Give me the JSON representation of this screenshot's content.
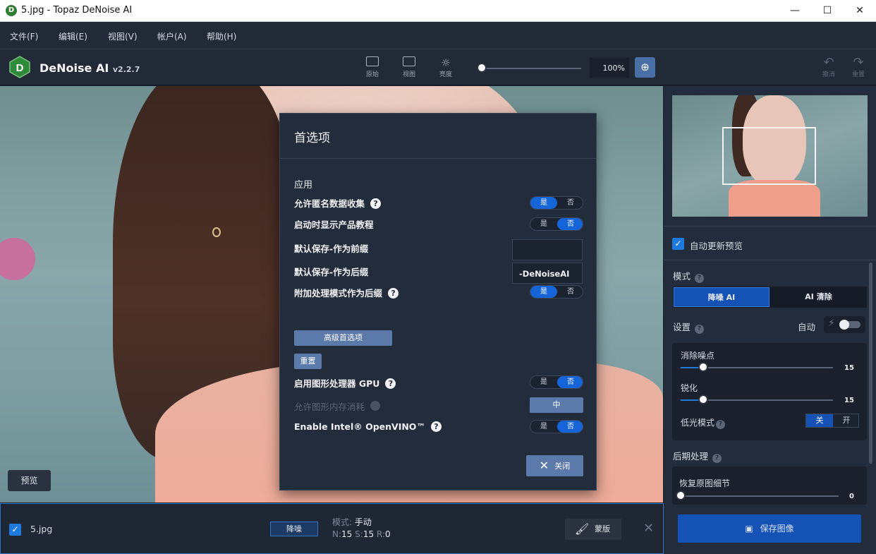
{
  "window": {
    "title": "5.jpg - Topaz DeNoise AI",
    "minimize": "—",
    "maximize": "☐",
    "close": "✕"
  },
  "menu": [
    "文件(F)",
    "编辑(E)",
    "视图(V)",
    "帐户(A)",
    "帮助(H)"
  ],
  "toolbar": {
    "brand": "DeNoise AI",
    "version": "v2.2.7",
    "buttons": [
      "原始",
      "视图",
      "亮度"
    ],
    "zoom": "100%",
    "zoom_fraction": 0.05,
    "undo": "撤消",
    "redo": "重置"
  },
  "preview_button": "预览",
  "dialog": {
    "title": "首选项",
    "section": "应用",
    "rows": [
      {
        "label": "允许匿名数据收集",
        "yes": "是",
        "no": "否",
        "selected": "yes"
      },
      {
        "label": "启动时显示产品教程",
        "yes": "是",
        "no": "否",
        "selected": "no"
      }
    ],
    "prefix_label": "默认保存-作为前缀",
    "prefix_value": "",
    "suffix_label": "默认保存-作为后缀",
    "suffix_value": "-DeNoiseAI",
    "append_mode": {
      "label": "附加处理模式作为后缀",
      "yes": "是",
      "no": "否",
      "selected": "yes"
    },
    "advanced_button": "高级首选项",
    "reset_button": "重置",
    "gpu": {
      "label": "启用图形处理器 GPU",
      "yes": "是",
      "no": "否",
      "selected": "no"
    },
    "memory": {
      "label": "允许图形内存消耗",
      "value": "中"
    },
    "openvino": {
      "label": "Enable Intel® OpenVINO™",
      "yes": "是",
      "no": "否",
      "selected": "no"
    },
    "close_button": "关闭"
  },
  "panel": {
    "auto_update": "自动更新预览",
    "mode_label": "模式",
    "modes": [
      "降噪 AI",
      "AI 清除"
    ],
    "settings_label": "设置",
    "auto_label": "自动",
    "noise_label": "消除噪点",
    "noise_value": "15",
    "sharpen_label": "锐化",
    "sharpen_value": "15",
    "lowlight_label": "低光模式",
    "lowlight_off": "关",
    "lowlight_on": "开",
    "post_label": "后期处理",
    "restore_label": "恢复原图细节",
    "restore_value": "0",
    "save_button": "保存图像"
  },
  "bottom": {
    "file": "5.jpg",
    "tag": "降噪",
    "mode_label": "模式:",
    "mode_value": "手动",
    "n_label": "N:",
    "n_value": "15",
    "s_label": "S:",
    "s_value": "15",
    "r_label": "R:",
    "r_value": "0",
    "mask_button": "蒙版"
  },
  "icons": [
    "app-icon",
    "help-icon",
    "zoom-in-icon",
    "undo-icon",
    "redo-icon",
    "checkbox-icon",
    "lightning-icon",
    "brush-icon",
    "save-icon",
    "close-icon"
  ]
}
